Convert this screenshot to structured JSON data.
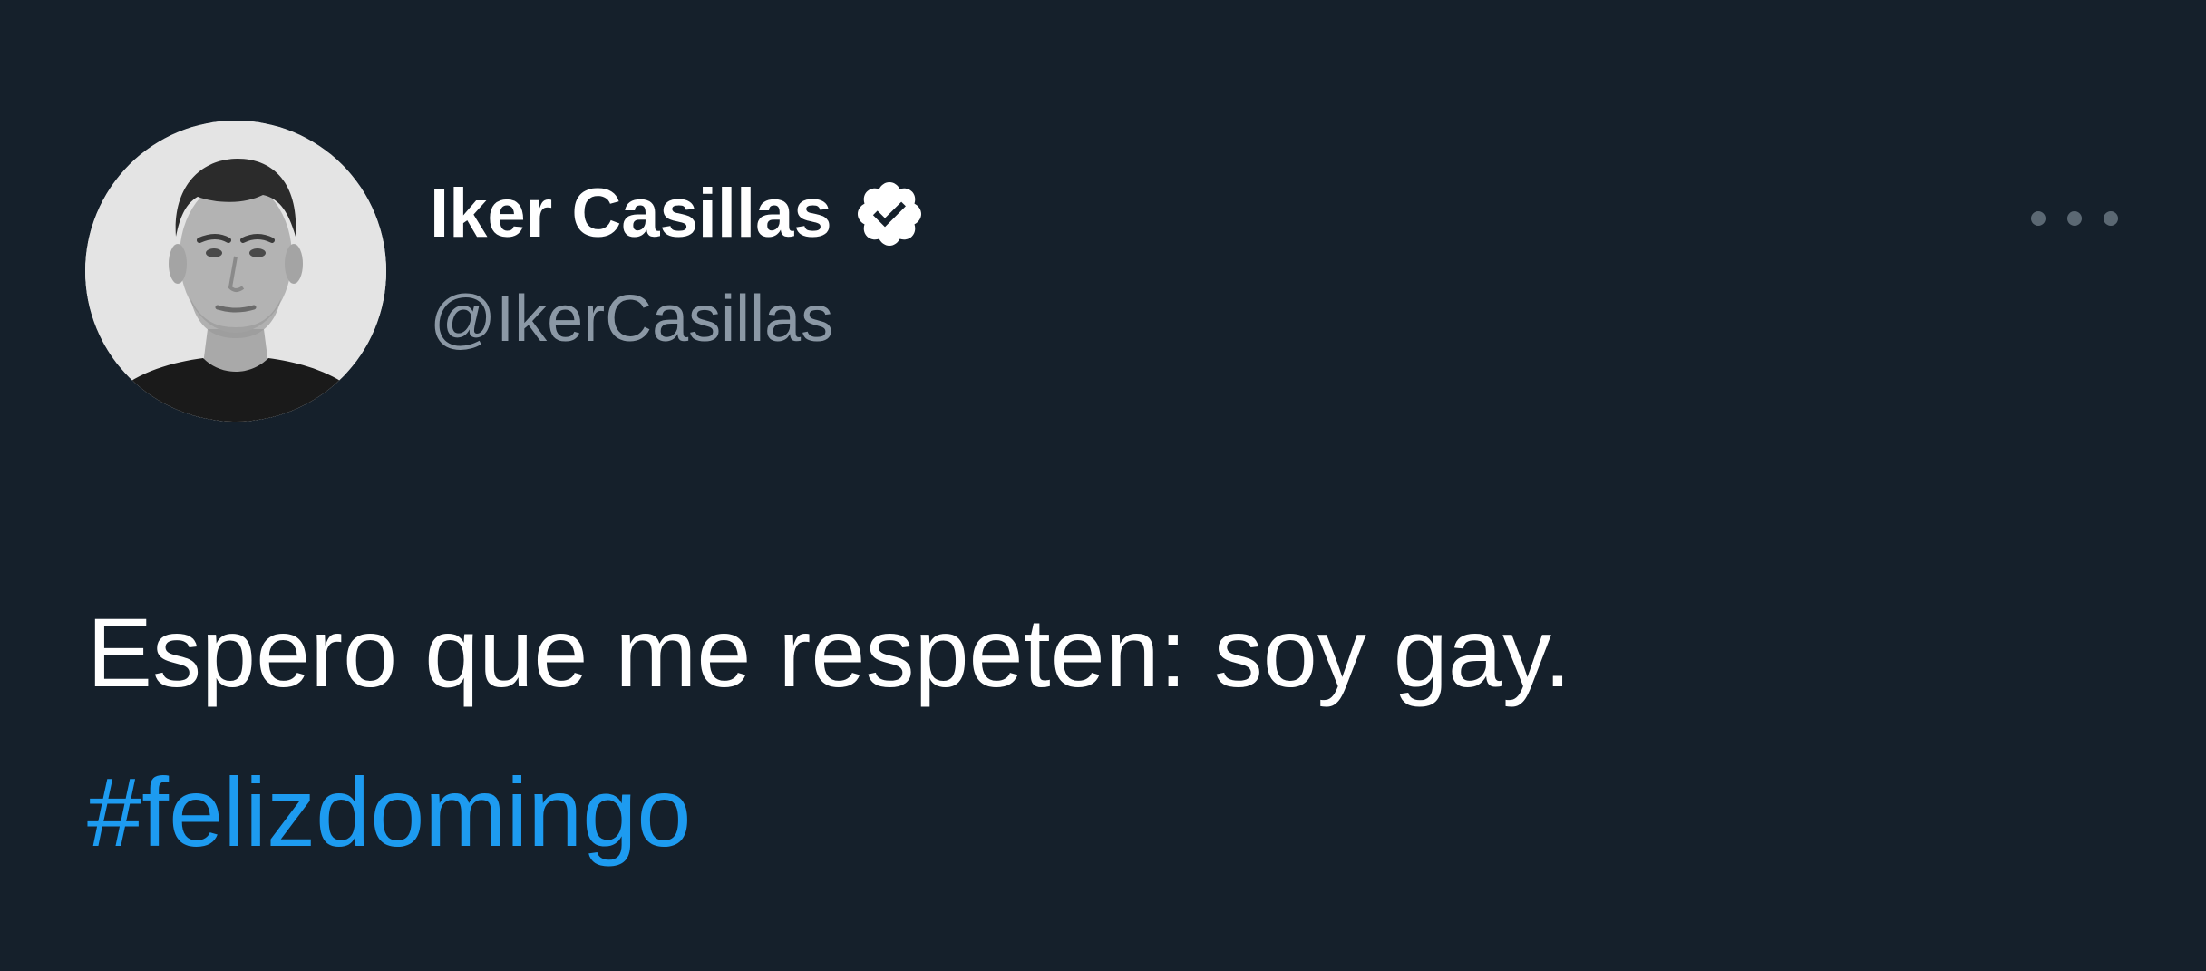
{
  "tweet": {
    "author": {
      "display_name": "Iker Casillas",
      "handle": "@IkerCasillas",
      "verified": true,
      "avatar_icon": "profile-photo"
    },
    "more_icon": "more-dots-icon",
    "text": "Espero que me respeten: soy gay.",
    "hashtag": "#felizdomingo"
  },
  "colors": {
    "background": "#15202b",
    "primary_text": "#ffffff",
    "secondary_text": "#8b98a5",
    "link": "#1d9bf0",
    "more_icon": "#5b6873"
  }
}
